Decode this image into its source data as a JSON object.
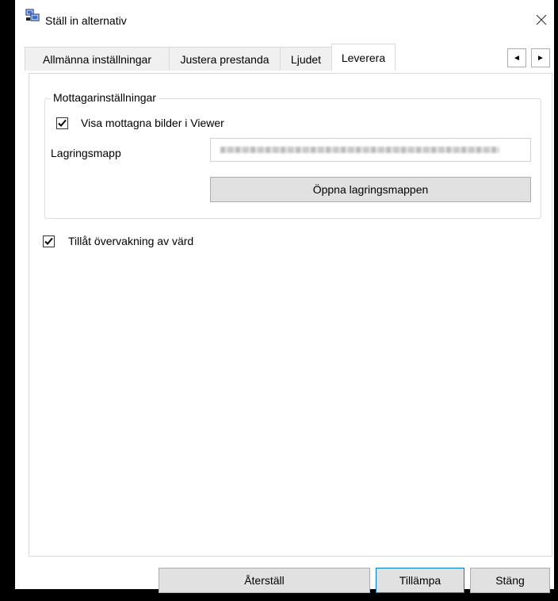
{
  "window": {
    "title": "Ställ in alternativ"
  },
  "tabs": [
    {
      "label": "Allmänna inställningar"
    },
    {
      "label": "Justera prestanda"
    },
    {
      "label": "Ljudet"
    },
    {
      "label": "Leverera"
    }
  ],
  "active_tab": "Leverera",
  "tab_nav": {
    "prev": "◄",
    "next": "►"
  },
  "receiver_group": {
    "legend": "Mottagarinställningar",
    "show_in_viewer": {
      "label": "Visa mottagna bilder i Viewer",
      "checked": true
    },
    "storage_label": "Lagringsmapp",
    "open_folder_button": "Öppna lagringsmappen"
  },
  "allow_host_monitoring": {
    "label": "Tillåt övervakning av värd",
    "checked": true
  },
  "footer": {
    "reset": "Återställ",
    "apply": "Tillämpa",
    "close": "Stäng"
  },
  "colors": {
    "accent": "#0078d7",
    "button_bg": "#e1e1e1",
    "tab_bg": "#f0f0f0"
  }
}
